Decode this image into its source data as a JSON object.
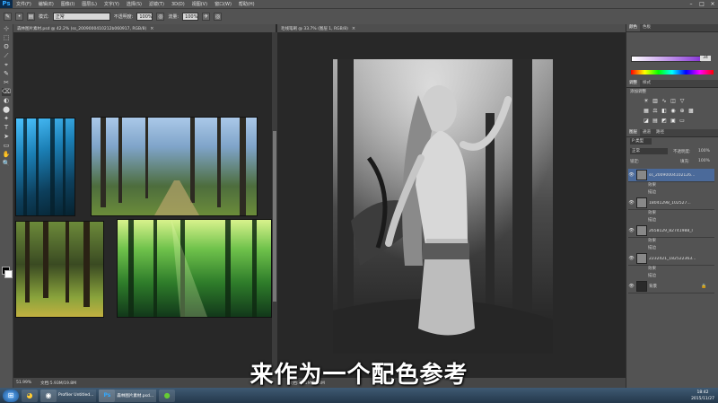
{
  "app": {
    "logo": "Ps"
  },
  "menu": [
    "文件(F)",
    "编辑(E)",
    "图像(I)",
    "图层(L)",
    "文字(Y)",
    "选择(S)",
    "滤镜(T)",
    "3D(D)",
    "视图(V)",
    "窗口(W)",
    "帮助(H)"
  ],
  "window_controls": [
    "–",
    "□",
    "×"
  ],
  "options_bar": {
    "mode_label": "模式:",
    "mode_value": "正常",
    "opacity_label": "不透明度:",
    "opacity_value": "100%",
    "flow_label": "流量:",
    "flow_value": "100%"
  },
  "tools": [
    "⊹",
    "⬚",
    "ʘ",
    "⟋",
    "⌖",
    "✎",
    "✂",
    "⌫",
    "◐",
    "⬤",
    "✦",
    "T",
    "➤",
    "▭",
    "✋",
    "🔍"
  ],
  "doc1": {
    "tab_title": "森林图片素材.psd @ 42.2% (ss_2009000410212b060917, RGB/8)",
    "close": "×",
    "status_zoom": "51.99%",
    "status_doc": "文档:5.93M/19.8M"
  },
  "doc2": {
    "tab_title": "毛线笔刷 @ 33.7% (图层 1, RGB/8)",
    "close": "×",
    "status_zoom": "",
    "status_doc": "文档:3.05M/5.93M"
  },
  "panels": {
    "color_tab": "颜色",
    "swatch_tab": "色板",
    "color_value": "34",
    "adj_tab": "调整",
    "style_tab": "样式",
    "adj_title": "添加调整",
    "layers_tab": "图层",
    "channels_tab": "通道",
    "paths_tab": "路径",
    "kind_label": "P 类型",
    "blend_mode": "正常",
    "opacity_label": "不透明度:",
    "opacity_value": "100%",
    "lock_label": "锁定:",
    "fill_label": "填充:",
    "fill_value": "100%"
  },
  "layers": [
    {
      "name": "ss_20090004102126...",
      "fx": [
        "效果",
        "描边"
      ],
      "selected": true
    },
    {
      "name": "18041298_102527...",
      "fx": [
        "效果",
        "描边"
      ],
      "selected": false
    },
    {
      "name": "2658129_82741988_l",
      "fx": [
        "效果",
        "描边"
      ],
      "selected": false
    },
    {
      "name": "2232421_182522363...",
      "fx": [
        "效果",
        "描边"
      ],
      "selected": false
    },
    {
      "name": "背景",
      "fx": [],
      "selected": false
    }
  ],
  "subtitle": "来作为一个配色参考",
  "taskbar": {
    "items": [
      "Profiler Untitled...",
      "森林图片素材.psd..."
    ],
    "clock_time": "18:42",
    "clock_date": "2015/11/27"
  }
}
